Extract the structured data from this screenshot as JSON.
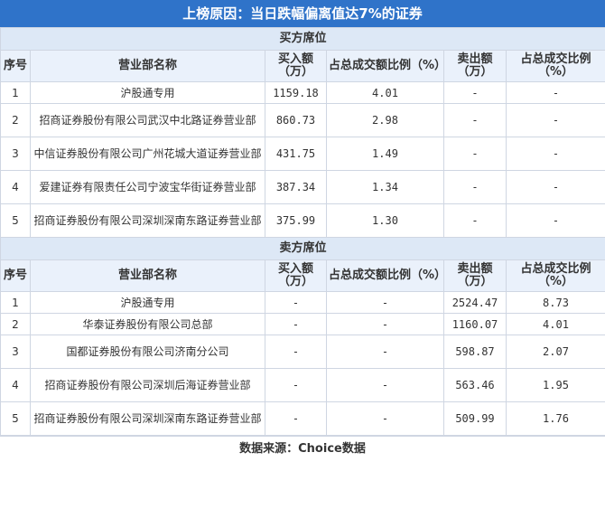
{
  "title": "上榜原因：当日跌幅偏离值达7%的证券",
  "columns": {
    "index": "序号",
    "dept": "营业部名称",
    "buy_amount": "买入额（万）",
    "buy_pct": "占总成交额比例（%）",
    "sell_amount": "卖出额（万）",
    "sell_pct": "占总成交比例（%）"
  },
  "buy_section": {
    "label": "买方席位",
    "rows": [
      {
        "idx": "1",
        "name": "沪股通专用",
        "buy": "1159.18",
        "buy_pct": "4.01",
        "sell": "-",
        "sell_pct": "-"
      },
      {
        "idx": "2",
        "name": "招商证券股份有限公司武汉中北路证券营业部",
        "buy": "860.73",
        "buy_pct": "2.98",
        "sell": "-",
        "sell_pct": "-"
      },
      {
        "idx": "3",
        "name": "中信证券股份有限公司广州花城大道证券营业部",
        "buy": "431.75",
        "buy_pct": "1.49",
        "sell": "-",
        "sell_pct": "-"
      },
      {
        "idx": "4",
        "name": "爱建证券有限责任公司宁波宝华街证券营业部",
        "buy": "387.34",
        "buy_pct": "1.34",
        "sell": "-",
        "sell_pct": "-"
      },
      {
        "idx": "5",
        "name": "招商证券股份有限公司深圳深南东路证券营业部",
        "buy": "375.99",
        "buy_pct": "1.30",
        "sell": "-",
        "sell_pct": "-"
      }
    ]
  },
  "sell_section": {
    "label": "卖方席位",
    "rows": [
      {
        "idx": "1",
        "name": "沪股通专用",
        "buy": "-",
        "buy_pct": "-",
        "sell": "2524.47",
        "sell_pct": "8.73"
      },
      {
        "idx": "2",
        "name": "华泰证券股份有限公司总部",
        "buy": "-",
        "buy_pct": "-",
        "sell": "1160.07",
        "sell_pct": "4.01"
      },
      {
        "idx": "3",
        "name": "国都证券股份有限公司济南分公司",
        "buy": "-",
        "buy_pct": "-",
        "sell": "598.87",
        "sell_pct": "2.07"
      },
      {
        "idx": "4",
        "name": "招商证券股份有限公司深圳后海证券营业部",
        "buy": "-",
        "buy_pct": "-",
        "sell": "563.46",
        "sell_pct": "1.95"
      },
      {
        "idx": "5",
        "name": "招商证券股份有限公司深圳深南东路证券营业部",
        "buy": "-",
        "buy_pct": "-",
        "sell": "509.99",
        "sell_pct": "1.76"
      }
    ]
  },
  "footer": "数据来源：Choice数据"
}
